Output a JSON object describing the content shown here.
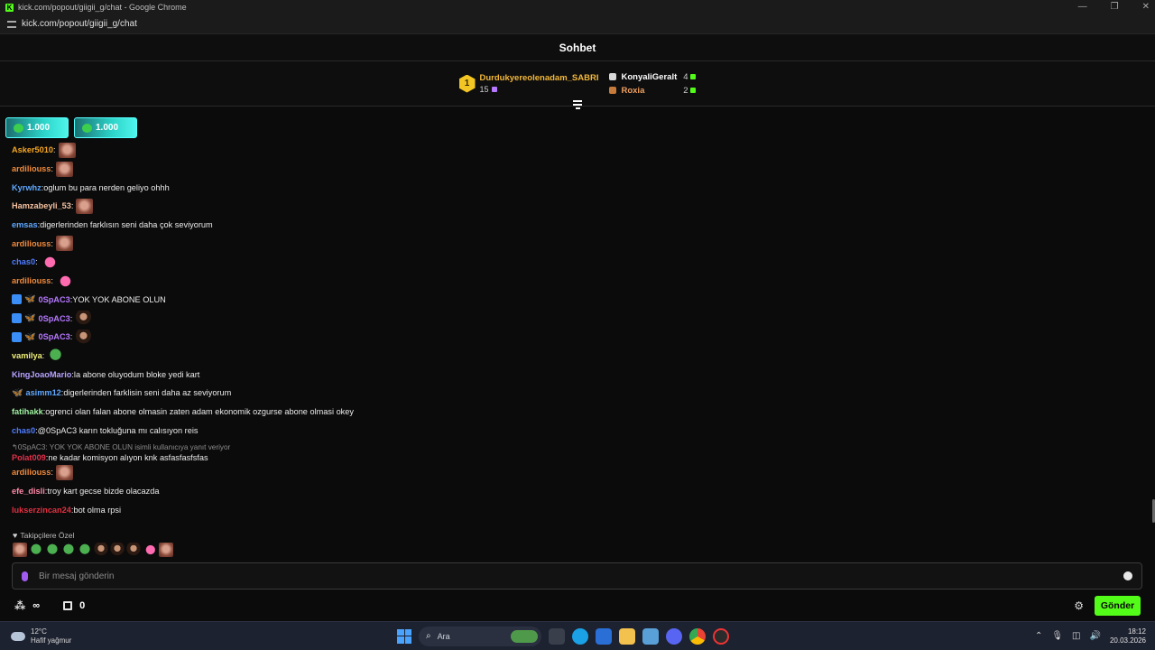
{
  "browser": {
    "title": "kick.com/popout/giigii_g/chat - Google Chrome",
    "url": "kick.com/popout/giigii_g/chat"
  },
  "header": {
    "title": "Sohbet"
  },
  "leaderboard": {
    "first": {
      "rank": "1",
      "name": "Durdukyereolenadam_SABRI",
      "count": "15",
      "color": "#f3b83a"
    },
    "others": [
      {
        "name": "KonyaliGeralt",
        "count": "4",
        "color": "#ffffff",
        "rank_color": "#d9d9d9"
      },
      {
        "name": "Roxia",
        "count": "2",
        "color": "#f0a060",
        "rank_color": "#c77b3a"
      }
    ]
  },
  "pinned": [
    {
      "amount": "1.000"
    },
    {
      "amount": "1.000"
    }
  ],
  "messages": [
    {
      "user": "Asker5010",
      "color": "#f5a623",
      "text": "",
      "emote": "face",
      "badges": []
    },
    {
      "user": "ardiliouss",
      "color": "#f08a3c",
      "text": "",
      "emote": "face",
      "badges": []
    },
    {
      "user": "Kyrwhz",
      "color": "#5ea8ff",
      "text": "oglum bu para nerden geliyo ohhh",
      "emote": "",
      "badges": []
    },
    {
      "user": "Hamzabeyli_53",
      "color": "#f6c2a0",
      "text": "",
      "emote": "face",
      "badges": []
    },
    {
      "user": "emsas",
      "color": "#5ea8ff",
      "text": "digerlerinden farklısın seni daha çok seviyorum",
      "emote": "",
      "badges": []
    },
    {
      "user": "ardiliouss",
      "color": "#f08a3c",
      "text": "",
      "emote": "face",
      "badges": []
    },
    {
      "user": "chas0",
      "color": "#4f7cff",
      "text": "",
      "emote": "pink",
      "badges": []
    },
    {
      "user": "ardiliouss",
      "color": "#f08a3c",
      "text": "",
      "emote": "pink",
      "badges": []
    },
    {
      "user": "0SpAC3",
      "color": "#b678ff",
      "text": "YOK YOK ABONE OLUN",
      "emote": "",
      "badges": [
        "blue",
        "bfly"
      ]
    },
    {
      "user": "0SpAC3",
      "color": "#b678ff",
      "text": "",
      "emote": "man",
      "badges": [
        "blue",
        "bfly"
      ]
    },
    {
      "user": "0SpAC3",
      "color": "#b678ff",
      "text": "",
      "emote": "man",
      "badges": [
        "blue",
        "bfly"
      ]
    },
    {
      "user": "vamilya",
      "color": "#f0f07a",
      "text": "",
      "emote": "pepe",
      "badges": []
    },
    {
      "user": "KingJoaoMario",
      "color": "#b8a2ff",
      "text": "la abone oluyodum bloke yedi kart",
      "emote": "",
      "badges": []
    },
    {
      "user": "asimm12",
      "color": "#5ea8ff",
      "text": "digerlerinden farklisin seni daha az seviyorum",
      "emote": "",
      "badges": [
        "bfly-orange"
      ]
    },
    {
      "user": "fatihakk",
      "color": "#9ff0a0",
      "text": "ogrenci olan falan abone olmasin zaten adam ekonomik ozgurse abone olmasi okey",
      "emote": "",
      "badges": []
    },
    {
      "user": "chas0",
      "color": "#4f7cff",
      "text": "@0SpAC3 karın tokluğuna mı calısıyon reis",
      "emote": "",
      "badges": []
    },
    {
      "reply": "0SpAC3: YOK YOK ABONE OLUN isimli kullanıcıya yanıt veriyor",
      "user": "Polat009",
      "color": "#e0304a",
      "text": "ne kadar komisyon alıyon knk asfasfasfsfas",
      "emote": "",
      "badges": []
    },
    {
      "user": "ardiliouss",
      "color": "#f08a3c",
      "text": "",
      "emote": "face",
      "badges": []
    },
    {
      "user": "efe_disli",
      "color": "#ff8aa8",
      "text": "troy kart gecse bizde olacazda",
      "emote": "",
      "badges": []
    },
    {
      "user": "lukserzincan24",
      "color": "#e03040",
      "text": "bot olma rpsi",
      "emote": "",
      "badges": []
    }
  ],
  "followers_only": {
    "label": "Takipçilere Özel"
  },
  "emote_bar": [
    "face",
    "pepe",
    "pepe",
    "pepe",
    "pepe",
    "man",
    "man",
    "man",
    "pink",
    "face"
  ],
  "input": {
    "placeholder": "Bir mesaj gönderin"
  },
  "bottom": {
    "points": "∞",
    "store_count": "0",
    "send_label": "Gönder"
  },
  "taskbar": {
    "weather_temp": "12°C",
    "weather_desc": "Hafif yağmur",
    "search_label": "Ara",
    "time": "18:12",
    "date": "20.03.2026"
  },
  "colors": {
    "accent": "#53fc18",
    "background": "#0b0b0c"
  }
}
